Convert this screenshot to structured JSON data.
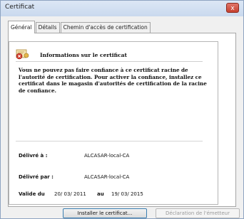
{
  "window": {
    "title": "Certificat",
    "close_label": "x"
  },
  "tabs": [
    {
      "label": "Général",
      "active": true
    },
    {
      "label": "Détails",
      "active": false
    },
    {
      "label": "Chemin d'accès de certification",
      "active": false
    }
  ],
  "info": {
    "icon": "certificate-warning-icon",
    "heading": "Informations sur le certificat",
    "warning": "Vous ne pouvez pas faire confiance à ce certificat racine de l'autorité de certification. Pour activer la confiance, installez ce certificat dans le magasin d'autorités de certification de la racine de confiance."
  },
  "fields": {
    "issued_to_label": "Délivré à :",
    "issued_to_value": "ALCASAR-local-CA",
    "issued_by_label": "Délivré par :",
    "issued_by_value": "ALCASAR-local-CA",
    "valid_from_label": "Valide du",
    "valid_from": "20/ 03/ 2011",
    "valid_to_label": "au",
    "valid_to": "19/ 03/ 2015"
  },
  "buttons": {
    "install": "Installer le certificat...",
    "issuer": "Déclaration de l'émetteur"
  },
  "colors": {
    "close_red": "#c6402f",
    "title_bar": "#c9d9ee",
    "disabled_text": "#9a9a9a"
  }
}
